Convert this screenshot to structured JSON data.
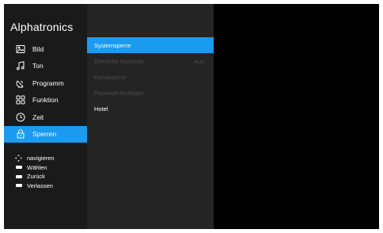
{
  "brand": "Alphatronics",
  "menu": [
    {
      "label": "Bild",
      "icon": "picture-icon"
    },
    {
      "label": "Ton",
      "icon": "music-note-icon"
    },
    {
      "label": "Programm",
      "icon": "satellite-dish-icon"
    },
    {
      "label": "Funktion",
      "icon": "grid-icon"
    },
    {
      "label": "Zeit",
      "icon": "clock-icon"
    },
    {
      "label": "Sperren",
      "icon": "lock-icon",
      "active": true
    }
  ],
  "submenu": [
    {
      "label": "Systemsperre",
      "active": true
    },
    {
      "label": "Elterliche Kontrolle",
      "value": "Aus",
      "disabled": true
    },
    {
      "label": "Kanalsperre",
      "disabled": true
    },
    {
      "label": "Passwort festlegen",
      "disabled": true
    },
    {
      "label": "Hotel"
    }
  ],
  "hints": [
    {
      "label": "navigieren",
      "icon": "dpad-icon"
    },
    {
      "label": "Wählen",
      "icon": "ok-key-icon"
    },
    {
      "label": "Zurück",
      "icon": "back-key-icon"
    },
    {
      "label": "Verlassen",
      "icon": "exit-key-icon"
    }
  ],
  "colors": {
    "accent": "#1b9bf0",
    "disabled_text": "#4d4d4d"
  }
}
